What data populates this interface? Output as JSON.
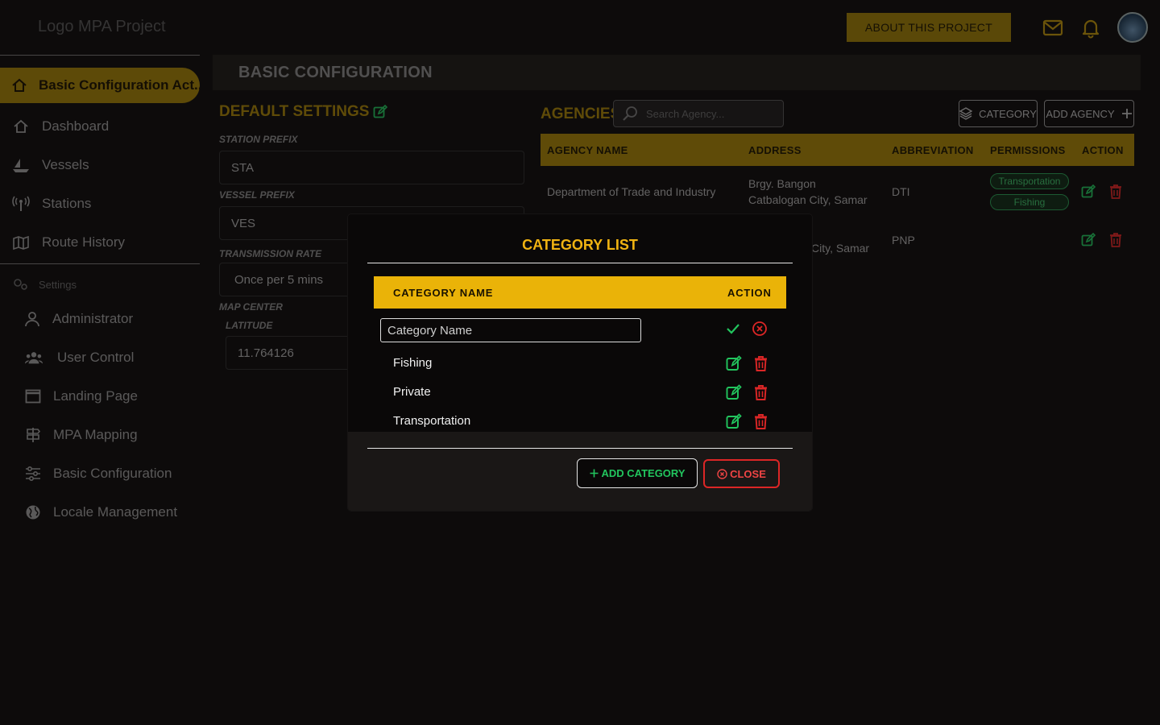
{
  "app": {
    "logo_text": "Logo MPA Project",
    "about_label": "ABOUT THIS PROJECT"
  },
  "sidebar": {
    "active_label": "Basic Configuration Act...",
    "items": [
      {
        "label": "Dashboard",
        "icon": "home-icon"
      },
      {
        "label": "Vessels",
        "icon": "boat-icon"
      },
      {
        "label": "Stations",
        "icon": "antenna-icon"
      },
      {
        "label": "Route History",
        "icon": "map-icon"
      }
    ],
    "settings_label": "Settings",
    "settings_items": [
      {
        "label": "Administrator",
        "icon": "user-icon"
      },
      {
        "label": "User Control",
        "icon": "users-icon"
      },
      {
        "label": "Landing Page",
        "icon": "window-icon"
      },
      {
        "label": "MPA Mapping",
        "icon": "signpost-icon"
      },
      {
        "label": "Basic Configuration",
        "icon": "sliders-icon"
      },
      {
        "label": "Locale Management",
        "icon": "globe-icon"
      }
    ]
  },
  "main": {
    "title": "BASIC CONFIGURATION",
    "defaults": {
      "title": "DEFAULT SETTINGS",
      "station_prefix_label": "STATION PREFIX",
      "station_prefix": "STA",
      "vessel_prefix_label": "VESSEL PREFIX",
      "vessel_prefix": "VES",
      "transmission_label": "TRANSMISSION RATE",
      "transmission": "Once per 5 mins",
      "map_center_label": "MAP CENTER",
      "latitude_label": "LATITUDE",
      "latitude": "11.764126"
    },
    "agencies": {
      "title": "AGENCIES",
      "search_placeholder": "Search Agency...",
      "category_button": "CATEGORY",
      "add_button": "ADD AGENCY",
      "columns": [
        "AGENCY NAME",
        "ADDRESS",
        "ABBREVIATION",
        "PERMISSIONS",
        "ACTION"
      ],
      "rows": [
        {
          "name": "Department of Trade and Industry",
          "address_line1": "Brgy. Bangon",
          "address_line2": "Catbalogan City, Samar",
          "abbr": "DTI",
          "permissions": [
            "Transportation",
            "Fishing"
          ]
        },
        {
          "name": "",
          "address_line1": "",
          "address_line2": "City, Samar",
          "abbr": "PNP",
          "permissions": []
        }
      ]
    }
  },
  "modal": {
    "title": "CATEGORY LIST",
    "col_name": "CATEGORY NAME",
    "col_action": "ACTION",
    "input_placeholder": "Category Name",
    "categories": [
      "Fishing",
      "Private",
      "Transportation"
    ],
    "add_label": "ADD CATEGORY",
    "close_label": "CLOSE"
  },
  "colors": {
    "accent": "#eab308",
    "success": "#22c55e",
    "danger": "#dc2626"
  }
}
